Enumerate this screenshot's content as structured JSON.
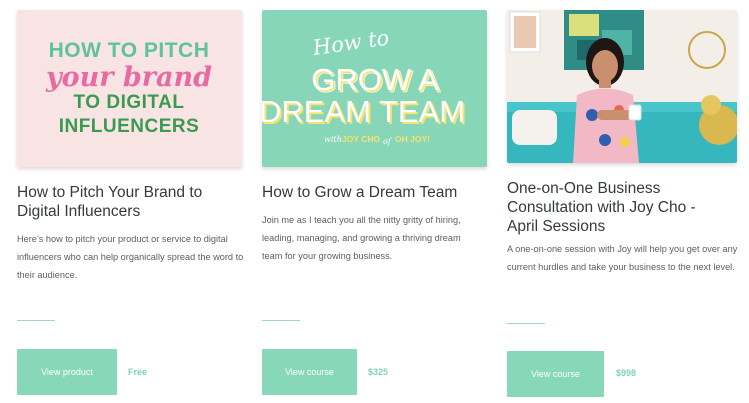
{
  "cards": [
    {
      "image": {
        "line1": "HOW TO PITCH",
        "line2": "your brand",
        "line3": "TO DIGITAL",
        "line4": "INFLUENCERS"
      },
      "title": "How to Pitch Your Brand to Digital Influencers",
      "description": "Here’s how to pitch your product or service to digital influencers who can help organically spread the word to their audience.",
      "button_label": "View product",
      "price": "Free"
    },
    {
      "image": {
        "line1": "How to",
        "line2": "GROW A",
        "line3": "DREAM TEAM",
        "byline_prefix": "with",
        "byline": "JOY CHO",
        "byline_of": "of",
        "byline_suffix": "OH JOY!"
      },
      "title": "How to Grow a Dream Team",
      "description": "Join me as I teach you all the nitty gritty of hiring, leading, managing, and growing a thriving dream team for your growing business.",
      "button_label": "View course",
      "price": "$325"
    },
    {
      "title": "One-on-One Business Consultation with Joy Cho - April Sessions",
      "description": "A one-on-one session with Joy will help you get over any current hurdles and take your business to the next level.",
      "button_label": "View course",
      "price": "$998"
    }
  ],
  "colors": {
    "accent": "#86d8b8",
    "price": "#7fd3b1",
    "pink_bg": "#f8e4e2",
    "mint_bg": "#86d6b7",
    "pitch_green": "#5fc39a",
    "pitch_pink": "#e86aa5",
    "pitch_dark_green": "#3a9a52"
  }
}
